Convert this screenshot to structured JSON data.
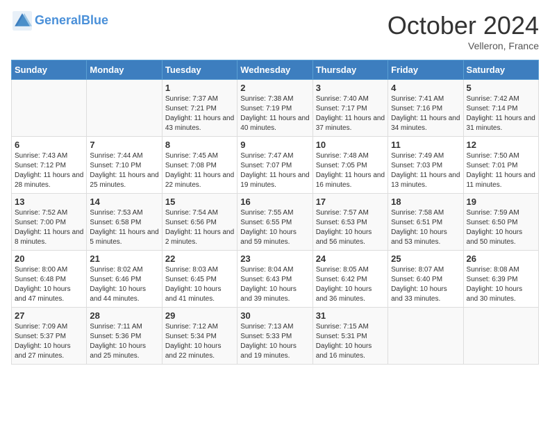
{
  "header": {
    "logo_line1": "General",
    "logo_line2": "Blue",
    "month": "October 2024",
    "location": "Velleron, France"
  },
  "days_of_week": [
    "Sunday",
    "Monday",
    "Tuesday",
    "Wednesday",
    "Thursday",
    "Friday",
    "Saturday"
  ],
  "weeks": [
    [
      {
        "day": "",
        "sunrise": "",
        "sunset": "",
        "daylight": ""
      },
      {
        "day": "",
        "sunrise": "",
        "sunset": "",
        "daylight": ""
      },
      {
        "day": "1",
        "sunrise": "Sunrise: 7:37 AM",
        "sunset": "Sunset: 7:21 PM",
        "daylight": "Daylight: 11 hours and 43 minutes."
      },
      {
        "day": "2",
        "sunrise": "Sunrise: 7:38 AM",
        "sunset": "Sunset: 7:19 PM",
        "daylight": "Daylight: 11 hours and 40 minutes."
      },
      {
        "day": "3",
        "sunrise": "Sunrise: 7:40 AM",
        "sunset": "Sunset: 7:17 PM",
        "daylight": "Daylight: 11 hours and 37 minutes."
      },
      {
        "day": "4",
        "sunrise": "Sunrise: 7:41 AM",
        "sunset": "Sunset: 7:16 PM",
        "daylight": "Daylight: 11 hours and 34 minutes."
      },
      {
        "day": "5",
        "sunrise": "Sunrise: 7:42 AM",
        "sunset": "Sunset: 7:14 PM",
        "daylight": "Daylight: 11 hours and 31 minutes."
      }
    ],
    [
      {
        "day": "6",
        "sunrise": "Sunrise: 7:43 AM",
        "sunset": "Sunset: 7:12 PM",
        "daylight": "Daylight: 11 hours and 28 minutes."
      },
      {
        "day": "7",
        "sunrise": "Sunrise: 7:44 AM",
        "sunset": "Sunset: 7:10 PM",
        "daylight": "Daylight: 11 hours and 25 minutes."
      },
      {
        "day": "8",
        "sunrise": "Sunrise: 7:45 AM",
        "sunset": "Sunset: 7:08 PM",
        "daylight": "Daylight: 11 hours and 22 minutes."
      },
      {
        "day": "9",
        "sunrise": "Sunrise: 7:47 AM",
        "sunset": "Sunset: 7:07 PM",
        "daylight": "Daylight: 11 hours and 19 minutes."
      },
      {
        "day": "10",
        "sunrise": "Sunrise: 7:48 AM",
        "sunset": "Sunset: 7:05 PM",
        "daylight": "Daylight: 11 hours and 16 minutes."
      },
      {
        "day": "11",
        "sunrise": "Sunrise: 7:49 AM",
        "sunset": "Sunset: 7:03 PM",
        "daylight": "Daylight: 11 hours and 13 minutes."
      },
      {
        "day": "12",
        "sunrise": "Sunrise: 7:50 AM",
        "sunset": "Sunset: 7:01 PM",
        "daylight": "Daylight: 11 hours and 11 minutes."
      }
    ],
    [
      {
        "day": "13",
        "sunrise": "Sunrise: 7:52 AM",
        "sunset": "Sunset: 7:00 PM",
        "daylight": "Daylight: 11 hours and 8 minutes."
      },
      {
        "day": "14",
        "sunrise": "Sunrise: 7:53 AM",
        "sunset": "Sunset: 6:58 PM",
        "daylight": "Daylight: 11 hours and 5 minutes."
      },
      {
        "day": "15",
        "sunrise": "Sunrise: 7:54 AM",
        "sunset": "Sunset: 6:56 PM",
        "daylight": "Daylight: 11 hours and 2 minutes."
      },
      {
        "day": "16",
        "sunrise": "Sunrise: 7:55 AM",
        "sunset": "Sunset: 6:55 PM",
        "daylight": "Daylight: 10 hours and 59 minutes."
      },
      {
        "day": "17",
        "sunrise": "Sunrise: 7:57 AM",
        "sunset": "Sunset: 6:53 PM",
        "daylight": "Daylight: 10 hours and 56 minutes."
      },
      {
        "day": "18",
        "sunrise": "Sunrise: 7:58 AM",
        "sunset": "Sunset: 6:51 PM",
        "daylight": "Daylight: 10 hours and 53 minutes."
      },
      {
        "day": "19",
        "sunrise": "Sunrise: 7:59 AM",
        "sunset": "Sunset: 6:50 PM",
        "daylight": "Daylight: 10 hours and 50 minutes."
      }
    ],
    [
      {
        "day": "20",
        "sunrise": "Sunrise: 8:00 AM",
        "sunset": "Sunset: 6:48 PM",
        "daylight": "Daylight: 10 hours and 47 minutes."
      },
      {
        "day": "21",
        "sunrise": "Sunrise: 8:02 AM",
        "sunset": "Sunset: 6:46 PM",
        "daylight": "Daylight: 10 hours and 44 minutes."
      },
      {
        "day": "22",
        "sunrise": "Sunrise: 8:03 AM",
        "sunset": "Sunset: 6:45 PM",
        "daylight": "Daylight: 10 hours and 41 minutes."
      },
      {
        "day": "23",
        "sunrise": "Sunrise: 8:04 AM",
        "sunset": "Sunset: 6:43 PM",
        "daylight": "Daylight: 10 hours and 39 minutes."
      },
      {
        "day": "24",
        "sunrise": "Sunrise: 8:05 AM",
        "sunset": "Sunset: 6:42 PM",
        "daylight": "Daylight: 10 hours and 36 minutes."
      },
      {
        "day": "25",
        "sunrise": "Sunrise: 8:07 AM",
        "sunset": "Sunset: 6:40 PM",
        "daylight": "Daylight: 10 hours and 33 minutes."
      },
      {
        "day": "26",
        "sunrise": "Sunrise: 8:08 AM",
        "sunset": "Sunset: 6:39 PM",
        "daylight": "Daylight: 10 hours and 30 minutes."
      }
    ],
    [
      {
        "day": "27",
        "sunrise": "Sunrise: 7:09 AM",
        "sunset": "Sunset: 5:37 PM",
        "daylight": "Daylight: 10 hours and 27 minutes."
      },
      {
        "day": "28",
        "sunrise": "Sunrise: 7:11 AM",
        "sunset": "Sunset: 5:36 PM",
        "daylight": "Daylight: 10 hours and 25 minutes."
      },
      {
        "day": "29",
        "sunrise": "Sunrise: 7:12 AM",
        "sunset": "Sunset: 5:34 PM",
        "daylight": "Daylight: 10 hours and 22 minutes."
      },
      {
        "day": "30",
        "sunrise": "Sunrise: 7:13 AM",
        "sunset": "Sunset: 5:33 PM",
        "daylight": "Daylight: 10 hours and 19 minutes."
      },
      {
        "day": "31",
        "sunrise": "Sunrise: 7:15 AM",
        "sunset": "Sunset: 5:31 PM",
        "daylight": "Daylight: 10 hours and 16 minutes."
      },
      {
        "day": "",
        "sunrise": "",
        "sunset": "",
        "daylight": ""
      },
      {
        "day": "",
        "sunrise": "",
        "sunset": "",
        "daylight": ""
      }
    ]
  ]
}
